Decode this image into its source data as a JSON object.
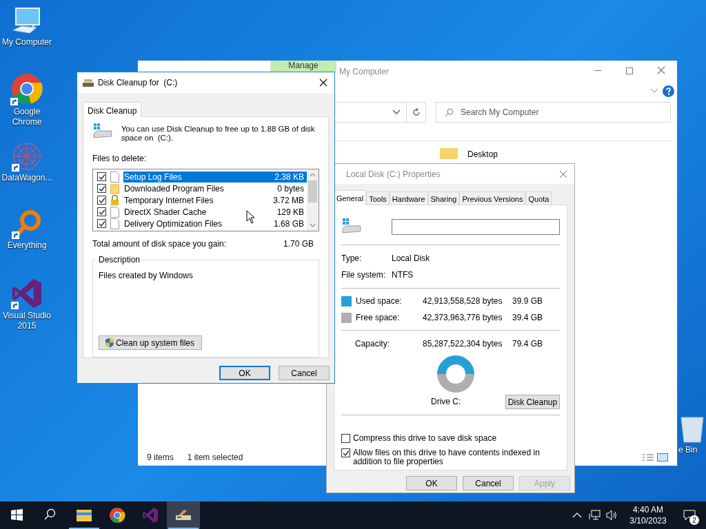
{
  "desktop_icons": [
    {
      "label": "My Computer",
      "kind": "computer",
      "shortcut": false
    },
    {
      "label": "Google Chrome",
      "kind": "chrome",
      "shortcut": true
    },
    {
      "label": "DataWagon...",
      "kind": "mesh",
      "shortcut": true
    },
    {
      "label": "Everything",
      "kind": "magnifier",
      "shortcut": true
    },
    {
      "label": "Visual Studio 2015",
      "kind": "vs",
      "shortcut": true
    }
  ],
  "recycle_bin": {
    "label": "e Bin"
  },
  "explorer": {
    "ribbon_tab": "Manage",
    "title": "My Computer",
    "search": {
      "placeholder": "Search My Computer"
    },
    "items": [
      {
        "label": "Desktop"
      }
    ],
    "status": [
      "9 items",
      "1 item selected"
    ]
  },
  "properties": {
    "title": "Local Disk (C:) Properties",
    "tabs": [
      {
        "label": "General",
        "selected": true
      },
      {
        "label": "Tools",
        "selected": false
      },
      {
        "label": "Hardware",
        "selected": false
      },
      {
        "label": "Sharing",
        "selected": false
      },
      {
        "label": "Previous Versions",
        "selected": false
      },
      {
        "label": "Quota",
        "selected": false
      }
    ],
    "info": [
      {
        "label": "Type:",
        "value": "Local Disk"
      },
      {
        "label": "File system:",
        "value": "NTFS"
      }
    ],
    "space": [
      {
        "label": "Used space:",
        "bytes": "42,913,558,528 bytes",
        "size": "39.9 GB",
        "color": "#26a0da"
      },
      {
        "label": "Free space:",
        "bytes": "42,373,963,776 bytes",
        "size": "39.4 GB",
        "color": "#aeaeae"
      }
    ],
    "capacity": {
      "label": "Capacity:",
      "bytes": "85,287,522,304 bytes",
      "size": "79.4 GB"
    },
    "drive_label": "Drive C:",
    "cleanup_button": "Disk Cleanup",
    "options": [
      {
        "label": "Compress this drive to save disk space",
        "checked": false
      },
      {
        "label": "Allow files on this drive to have contents indexed in addition to file properties",
        "checked": true
      }
    ],
    "buttons": [
      {
        "label": "OK",
        "disabled": false
      },
      {
        "label": "Cancel",
        "disabled": false
      },
      {
        "label": "Apply",
        "disabled": true
      }
    ]
  },
  "disk_cleanup": {
    "title": "Disk Cleanup for  (C:)",
    "tab": "Disk Cleanup",
    "intro": "You can use Disk Cleanup to free up to 1.88 GB of disk space on  (C:).",
    "files_label": "Files to delete:",
    "files": [
      {
        "name": "Setup Log Files",
        "size": "2.38 KB",
        "checked": true,
        "selected": true,
        "kind": "page"
      },
      {
        "name": "Downloaded Program Files",
        "size": "0 bytes",
        "checked": true,
        "selected": false,
        "kind": "folder"
      },
      {
        "name": "Temporary Internet Files",
        "size": "3.72 MB",
        "checked": true,
        "selected": false,
        "kind": "lock"
      },
      {
        "name": "DirectX Shader Cache",
        "size": "129 KB",
        "checked": true,
        "selected": false,
        "kind": "page"
      },
      {
        "name": "Delivery Optimization Files",
        "size": "1.68 GB",
        "checked": true,
        "selected": false,
        "kind": "page"
      }
    ],
    "total_label": "Total amount of disk space you gain:",
    "total": "1.70 GB",
    "description_label": "Description",
    "description": "Files created by Windows",
    "system_button": "Clean up system files",
    "buttons": [
      {
        "label": "OK",
        "default": true
      },
      {
        "label": "Cancel",
        "default": false
      }
    ]
  },
  "taskbar": {
    "apps": [
      {
        "kind": "folder",
        "running": true,
        "selected": false
      },
      {
        "kind": "chrome",
        "running": false,
        "selected": false
      },
      {
        "kind": "vs",
        "running": false,
        "selected": false
      },
      {
        "kind": "cleanup",
        "running": true,
        "selected": true
      }
    ],
    "time": "4:40 AM",
    "date": "3/10/2023",
    "notifications": "2"
  }
}
